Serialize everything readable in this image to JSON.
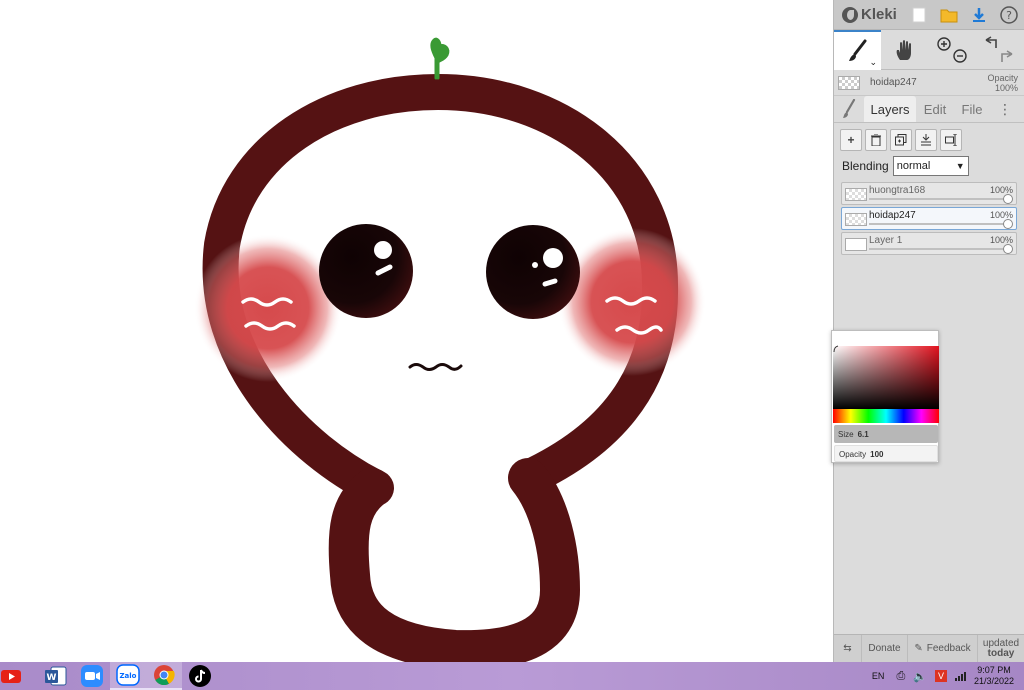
{
  "app": {
    "name": "Kleki"
  },
  "topbar_icons": [
    "new-image-icon",
    "open-folder-icon",
    "download-icon",
    "help-icon"
  ],
  "help_glyph": "?",
  "tools": [
    {
      "name": "brush",
      "active": true
    },
    {
      "name": "hand",
      "active": false
    },
    {
      "name": "zoom",
      "active": false
    },
    {
      "name": "undo-redo",
      "active": false
    }
  ],
  "current_layer": {
    "name": "hoidap247",
    "opacity_label": "Opacity",
    "opacity_value": "100%"
  },
  "tabs": [
    {
      "label": "Layers",
      "active": true
    },
    {
      "label": "Edit",
      "active": false
    },
    {
      "label": "File",
      "active": false
    }
  ],
  "layer_buttons": [
    "add-layer",
    "delete-layer",
    "duplicate-layer",
    "merge-down",
    "rename-layer"
  ],
  "blending": {
    "label": "Blending",
    "value": "normal"
  },
  "layers": [
    {
      "name": "huongtra168",
      "opacity": "100%",
      "selected": false
    },
    {
      "name": "hoidap247",
      "opacity": "100%",
      "selected": true
    },
    {
      "name": "Layer 1",
      "opacity": "100%",
      "selected": false
    }
  ],
  "bottom_bar": {
    "donate": "Donate",
    "feedback": "Feedback",
    "updated_line1": "updated",
    "updated_line2": "today"
  },
  "picker": {
    "size_label": "Size",
    "size_value": "6.1",
    "opacity_label": "Opacity",
    "opacity_value": "100",
    "hue_color": "#e2131f"
  },
  "drawing_colors": {
    "outline": "#551213",
    "blush": "#d64a4c",
    "leaf": "#3a9a34",
    "eye": "#180607"
  },
  "taskbar": {
    "apps": [
      "youtube",
      "word",
      "zoom",
      "zalo",
      "chrome",
      "tiktok"
    ],
    "zalo_label": "Zalo",
    "language": "EN",
    "time": "9:07 PM",
    "date": "21/3/2022"
  }
}
